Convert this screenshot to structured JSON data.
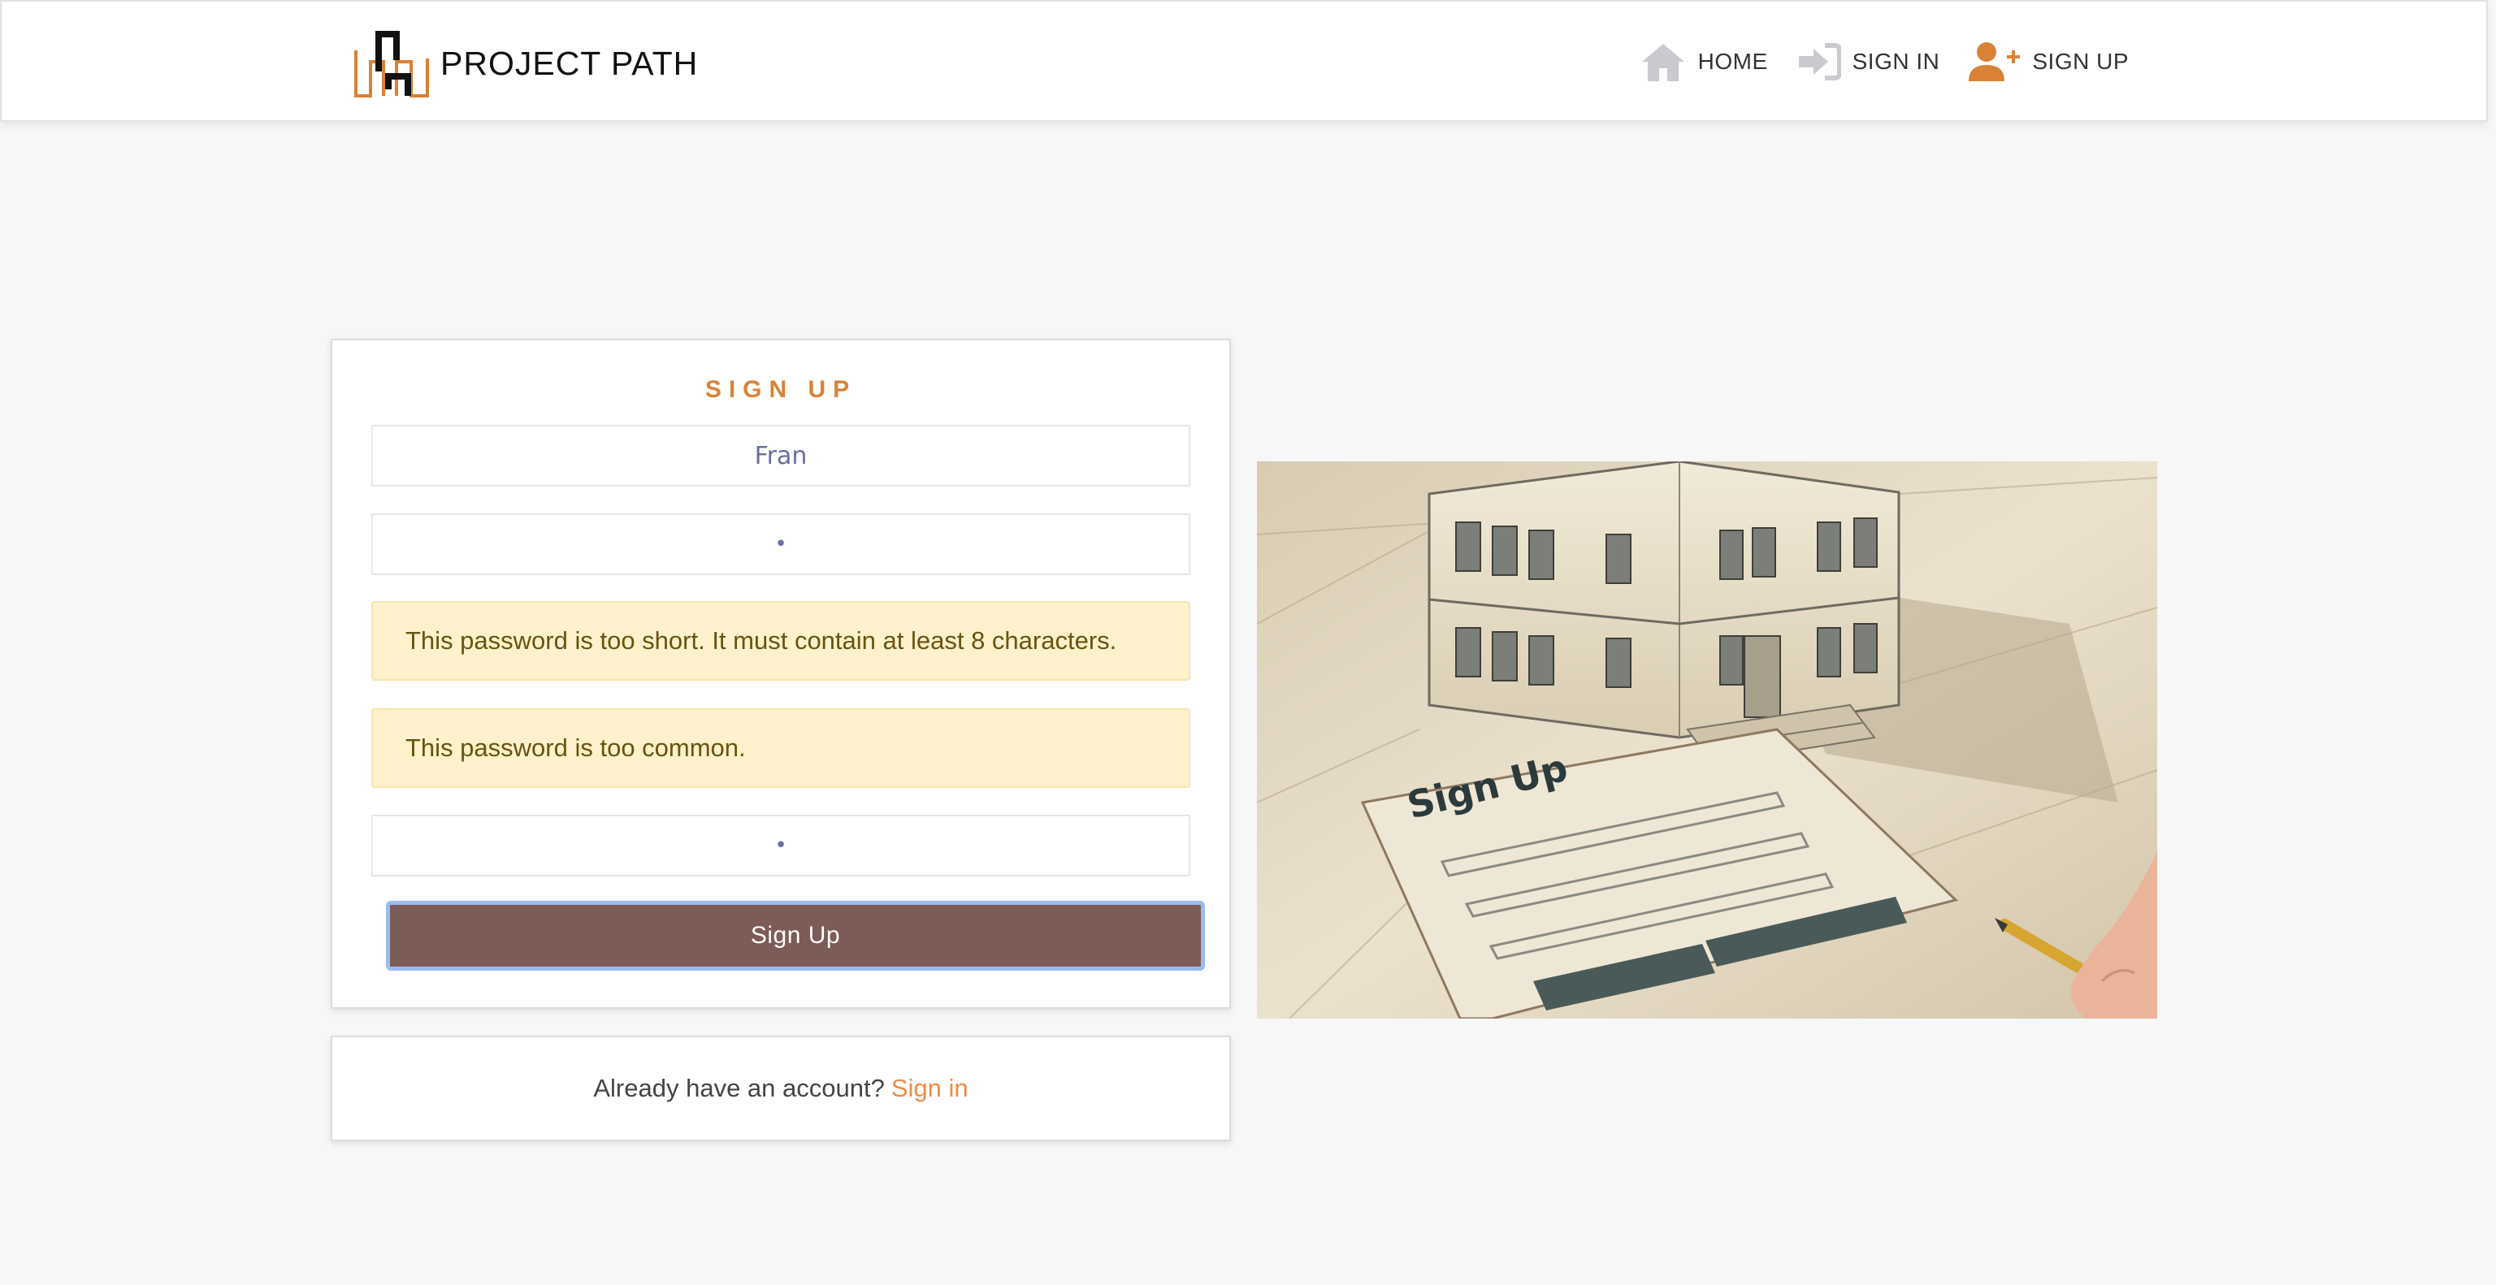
{
  "header": {
    "brand_name": "PROJECT PATH",
    "nav": [
      {
        "label": "HOME",
        "icon": "home-icon"
      },
      {
        "label": "SIGN IN",
        "icon": "sign-in-icon"
      },
      {
        "label": "SIGN UP",
        "icon": "user-plus-icon"
      }
    ]
  },
  "signup_form": {
    "title": "SIGN UP",
    "username_value": "Fran",
    "password1_value": "•",
    "password2_value": "•",
    "errors": [
      "This password is too short. It must contain at least 8 characters.",
      "This password is too common."
    ],
    "submit_label": "Sign Up"
  },
  "signin_prompt": {
    "text": "Already have an account?",
    "link_label": "Sign in"
  },
  "illustration": {
    "caption": "Sign Up"
  },
  "colors": {
    "accent": "#d98236",
    "link": "#f08a45",
    "button": "#7d5b56",
    "alert_bg": "#fff2cc",
    "alert_text": "#6a5310",
    "background": "#f7f7f7"
  }
}
